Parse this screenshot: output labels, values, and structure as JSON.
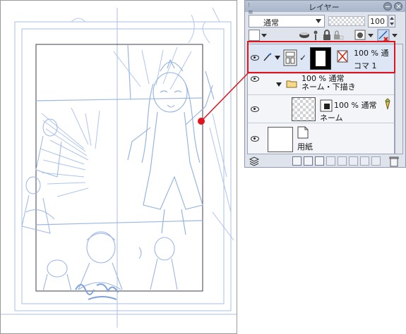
{
  "panel": {
    "title": "レイヤー",
    "blend_mode": "通常",
    "opacity": "100"
  },
  "layers": [
    {
      "opacity_mode": "100 % 通",
      "name": "コマ 1"
    },
    {
      "opacity_mode": "100 % 通常",
      "name": "ネーム・下描き"
    },
    {
      "opacity_mode": "100 % 通常",
      "name": "ネーム"
    },
    {
      "opacity_mode": "",
      "name": "用紙"
    }
  ],
  "colors": {
    "highlight": "#e0141e",
    "sketch": "#8fb0e0",
    "panel_bg": "#dfe4ec"
  }
}
